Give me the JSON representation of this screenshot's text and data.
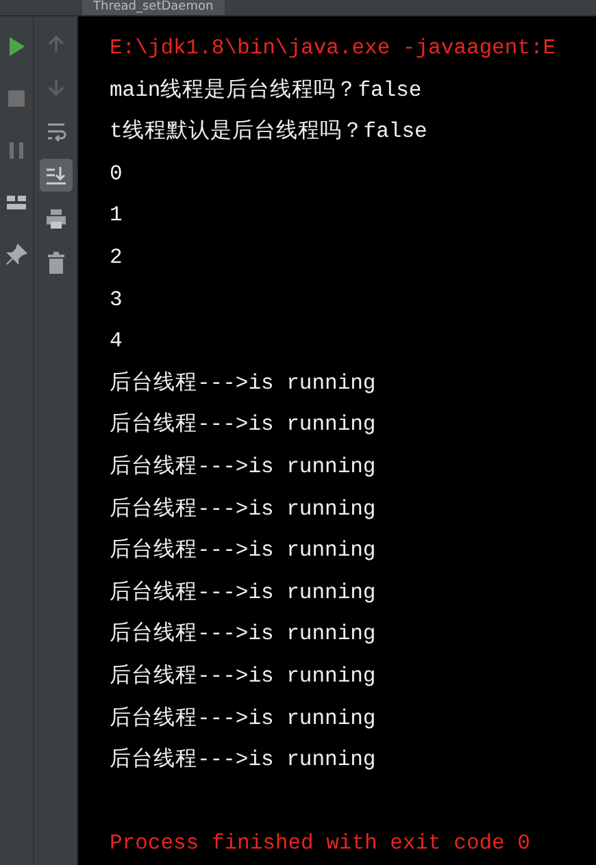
{
  "tabs": [
    {
      "label": "Thread_setDaemon",
      "selected": true
    }
  ],
  "run_toolbar": [
    {
      "kind": "run"
    },
    {
      "kind": "stop"
    },
    {
      "kind": "pause"
    },
    {
      "kind": "layout"
    },
    {
      "kind": "pin"
    }
  ],
  "console_toolbar": [
    {
      "kind": "up",
      "selected": false
    },
    {
      "kind": "down",
      "selected": false
    },
    {
      "kind": "wrap",
      "selected": false
    },
    {
      "kind": "scroll-end",
      "selected": true
    },
    {
      "kind": "print",
      "selected": false
    },
    {
      "kind": "trash",
      "selected": false
    }
  ],
  "console": {
    "lines": [
      {
        "kind": "command",
        "text": "E:\\jdk1.8\\bin\\java.exe -javaagent:E"
      },
      {
        "kind": "output",
        "text": "main线程是后台线程吗？false"
      },
      {
        "kind": "output",
        "text": "t线程默认是后台线程吗？false"
      },
      {
        "kind": "output",
        "text": "0"
      },
      {
        "kind": "output",
        "text": "1"
      },
      {
        "kind": "output",
        "text": "2"
      },
      {
        "kind": "output",
        "text": "3"
      },
      {
        "kind": "output",
        "text": "4"
      },
      {
        "kind": "output",
        "text": "后台线程--->is running"
      },
      {
        "kind": "output",
        "text": "后台线程--->is running"
      },
      {
        "kind": "output",
        "text": "后台线程--->is running"
      },
      {
        "kind": "output",
        "text": "后台线程--->is running"
      },
      {
        "kind": "output",
        "text": "后台线程--->is running"
      },
      {
        "kind": "output",
        "text": "后台线程--->is running"
      },
      {
        "kind": "output",
        "text": "后台线程--->is running"
      },
      {
        "kind": "output",
        "text": "后台线程--->is running"
      },
      {
        "kind": "output",
        "text": "后台线程--->is running"
      },
      {
        "kind": "output",
        "text": "后台线程--->is running"
      },
      {
        "kind": "blank"
      },
      {
        "kind": "exit",
        "text": "Process finished with exit code 0"
      }
    ]
  }
}
